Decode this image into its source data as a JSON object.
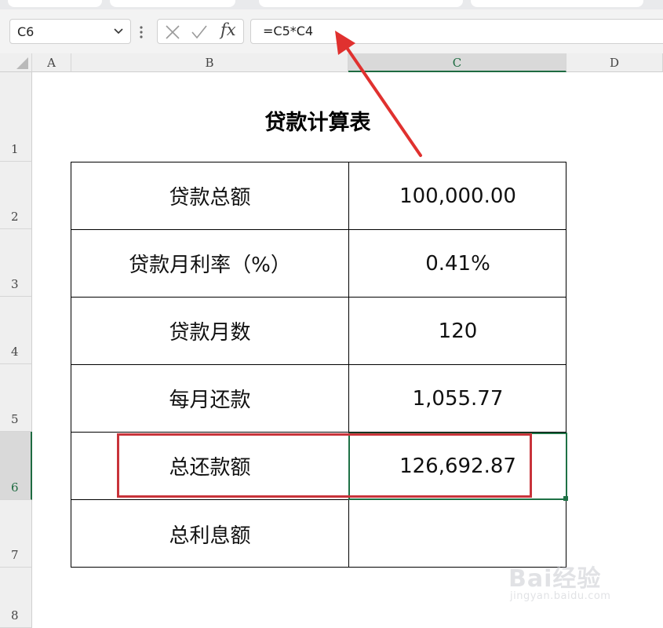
{
  "formula_bar": {
    "name_box": "C6",
    "fx_label": "fx",
    "formula": "=C5*C4"
  },
  "columns": [
    "A",
    "B",
    "C",
    "D"
  ],
  "rows": [
    "1",
    "2",
    "3",
    "4",
    "5",
    "6",
    "7",
    "8"
  ],
  "selected_cell": "C6",
  "sheet": {
    "title": "贷款计算表",
    "table": [
      {
        "label": "贷款总额",
        "value": "100,000.00"
      },
      {
        "label": "贷款月利率（%）",
        "value": "0.41%"
      },
      {
        "label": "贷款月数",
        "value": "120"
      },
      {
        "label": "每月还款",
        "value": "1,055.77"
      },
      {
        "label": "总还款额",
        "value": "126,692.87"
      },
      {
        "label": "总利息额",
        "value": ""
      }
    ]
  },
  "annotation": {
    "highlight_color": "#c8333a",
    "arrow_color": "#e0312f"
  },
  "watermark": {
    "brand": "Bai经验",
    "url": "jingyan.baidu.com"
  },
  "colors": {
    "excel_green": "#1e7145",
    "header_bg": "#efefef"
  }
}
